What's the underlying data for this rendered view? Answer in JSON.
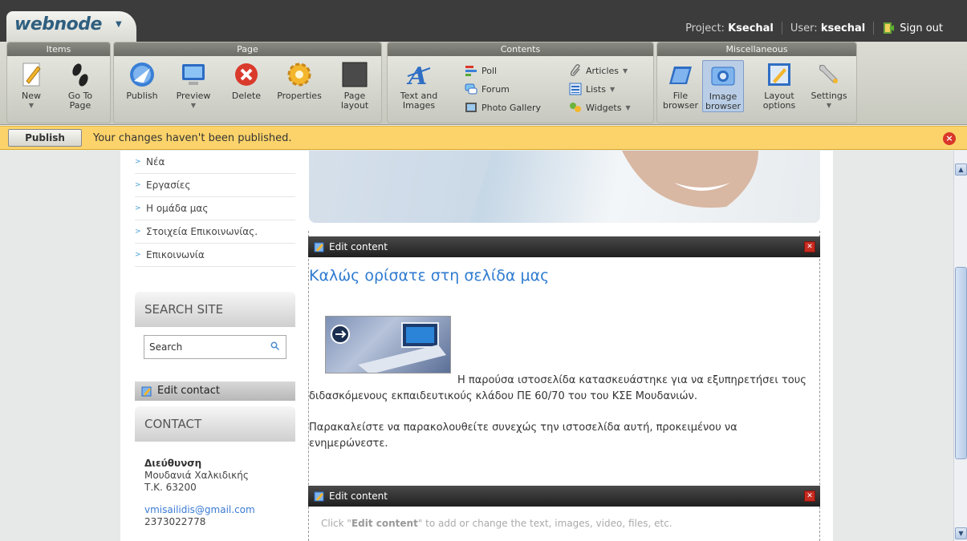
{
  "header": {
    "logo": "webnode",
    "project_label": "Project:",
    "project_name": "Ksechal",
    "user_label": "User:",
    "user_name": "ksechal",
    "signout": "Sign out"
  },
  "ribbon": {
    "groups": {
      "items": "Items",
      "page": "Page",
      "contents": "Contents",
      "misc": "Miscellaneous"
    },
    "tools": {
      "new": "New",
      "goto": "Go To\nPage",
      "publish": "Publish",
      "preview": "Preview",
      "delete": "Delete",
      "properties": "Properties",
      "page_layout": "Page\nlayout",
      "text_images": "Text and\nImages",
      "poll": "Poll",
      "forum": "Forum",
      "photo_gallery": "Photo Gallery",
      "articles": "Articles",
      "lists": "Lists",
      "widgets": "Widgets",
      "file_browser": "File\nbrowser",
      "image_browser": "Image\nbrowser",
      "layout_options": "Layout\noptions",
      "settings": "Settings"
    }
  },
  "notification": {
    "button": "Publish",
    "message": "Your changes haven't been published."
  },
  "sidebar": {
    "nav": [
      "Νέα",
      "Εργασίες",
      "Η ομάδα μας",
      "Στοιχεία Επικοινωνίας.",
      "Επικοινωνία"
    ],
    "search_title": "SEARCH SITE",
    "search_value": "Search",
    "edit_contact": "Edit contact",
    "contact_title": "CONTACT",
    "address_label": "Διεύθυνση",
    "address_line1": "Μουδανιά Χαλκιδικής",
    "address_line2": "Τ.Κ. 63200",
    "email": "vmisailidis@gmail.com",
    "phone": "2373022778"
  },
  "main": {
    "edit_content": "Edit content",
    "heading": "Καλώς ορίσατε στη σελίδα μας",
    "para1a": "Η παρούσα ιστοσελίδα κατασκευάστηκε για να εξυπηρετήσει τους",
    "para1b": "διδασκόμενους εκπαιδευτικούς  κλάδου ΠΕ 60/70 του του ΚΣΕ Μουδανιών.",
    "para2": "Παρακαλείστε να παρακολουθείτε συνεχώς την ιστοσελίδα αυτή, προκειμένου να ενημερώνεστε.",
    "edit_content_2": "Edit content",
    "placeholder_pre": "Click \"",
    "placeholder_bold": "Edit content",
    "placeholder_post": "\" to add or change the text, images, video, files, etc."
  },
  "colors": {
    "accent": "#2f7bd0",
    "notify_bg": "#fbd36a",
    "topbar": "#3c3c3c"
  }
}
